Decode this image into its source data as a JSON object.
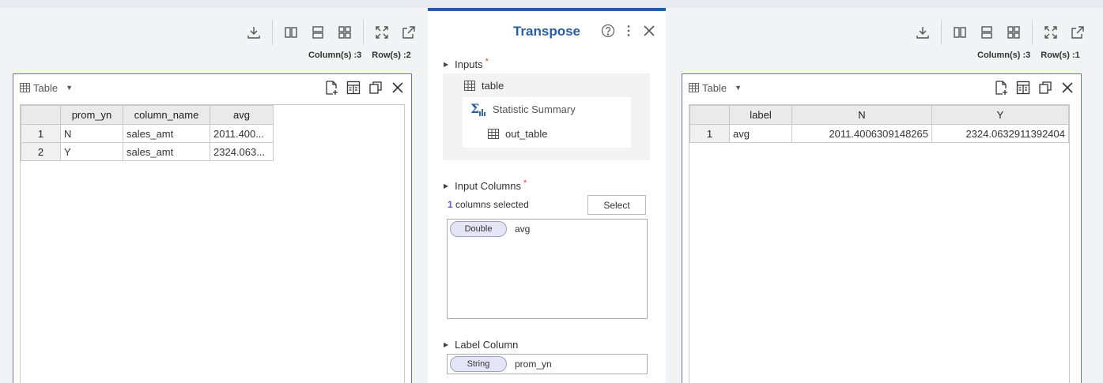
{
  "left": {
    "row_col_info": {
      "columns": "Column(s) :3",
      "rows": "Row(s) :2"
    },
    "view_label": "Table",
    "table": {
      "headers": [
        "prom_yn",
        "column_name",
        "avg"
      ],
      "rows": [
        {
          "n": "1",
          "cells": [
            "N",
            "sales_amt",
            "2011.400..."
          ]
        },
        {
          "n": "2",
          "cells": [
            "Y",
            "sales_amt",
            "2324.063..."
          ]
        }
      ]
    }
  },
  "dialog": {
    "title": "Transpose",
    "inputs": {
      "label": "Inputs",
      "required": "*",
      "table": "table",
      "node": "Statistic Summary",
      "out": "out_table"
    },
    "input_columns": {
      "label": "Input Columns",
      "required": "*",
      "count": "1",
      "count_text": "columns selected",
      "select_button": "Select",
      "items": [
        {
          "type": "Double",
          "name": "avg"
        }
      ]
    },
    "label_column": {
      "label": "Label Column",
      "type": "String",
      "name": "prom_yn"
    }
  },
  "right": {
    "row_col_info": {
      "columns": "Column(s) :3",
      "rows": "Row(s) :1"
    },
    "view_label": "Table",
    "table": {
      "headers": [
        "label",
        "N",
        "Y"
      ],
      "rows": [
        {
          "n": "1",
          "cells": [
            "avg",
            "2011.4006309148265",
            "2324.0632911392404"
          ]
        }
      ]
    }
  },
  "icons": {
    "download": "download-icon",
    "split_vertical": "split-vertical-icon",
    "split_horizontal": "split-horizontal-icon",
    "grid4": "grid-four-icon",
    "expand": "expand-icon",
    "popout": "popout-icon"
  },
  "colors": {
    "accent": "#2a5d9f",
    "panel_border": "#6a73c8",
    "required": "#e0403a",
    "chip_bg": "#e4e6f7"
  }
}
